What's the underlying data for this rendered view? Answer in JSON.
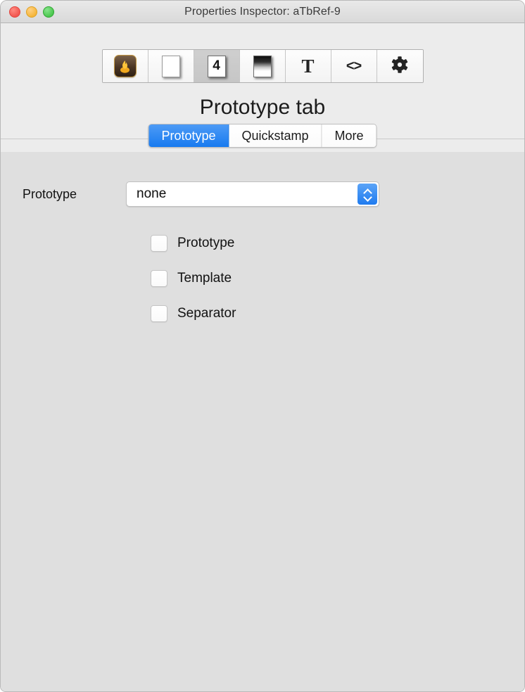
{
  "window": {
    "title": "Properties Inspector: aTbRef-9",
    "traffic_lights": [
      {
        "name": "close",
        "color": "#f25750"
      },
      {
        "name": "minimize",
        "color": "#f5b63b"
      },
      {
        "name": "maximize",
        "color": "#4cc74f"
      }
    ]
  },
  "toolbar": {
    "buttons": [
      {
        "id": "app",
        "icon": "flame-icon",
        "label": "Flame",
        "selected": false
      },
      {
        "id": "basic",
        "icon": "note-page-icon",
        "label": "Note",
        "selected": false
      },
      {
        "id": "prototype",
        "icon": "numbered-note-icon",
        "label": "4",
        "selected": true
      },
      {
        "id": "container",
        "icon": "container-note-icon",
        "label": "Container",
        "selected": false
      },
      {
        "id": "text",
        "icon": "text-t-icon",
        "label": "T",
        "selected": false
      },
      {
        "id": "code",
        "icon": "code-brackets-icon",
        "label": "<>",
        "selected": false
      },
      {
        "id": "settings",
        "icon": "gear-icon",
        "label": "Settings",
        "selected": false
      }
    ]
  },
  "heading": "Prototype tab",
  "tabs": [
    {
      "label": "Prototype",
      "active": true
    },
    {
      "label": "Quickstamp",
      "active": false
    },
    {
      "label": "More",
      "active": false
    }
  ],
  "form": {
    "prototype_field": {
      "label": "Prototype",
      "value": "none"
    },
    "checkboxes": [
      {
        "label": "Prototype",
        "checked": false
      },
      {
        "label": "Template",
        "checked": false
      },
      {
        "label": "Separator",
        "checked": false
      }
    ]
  },
  "colors": {
    "accent": "#187bf0",
    "header_bg": "#ececec",
    "panel_bg": "#dfdfdf",
    "titlebar_bg": "#d9d9d9"
  }
}
